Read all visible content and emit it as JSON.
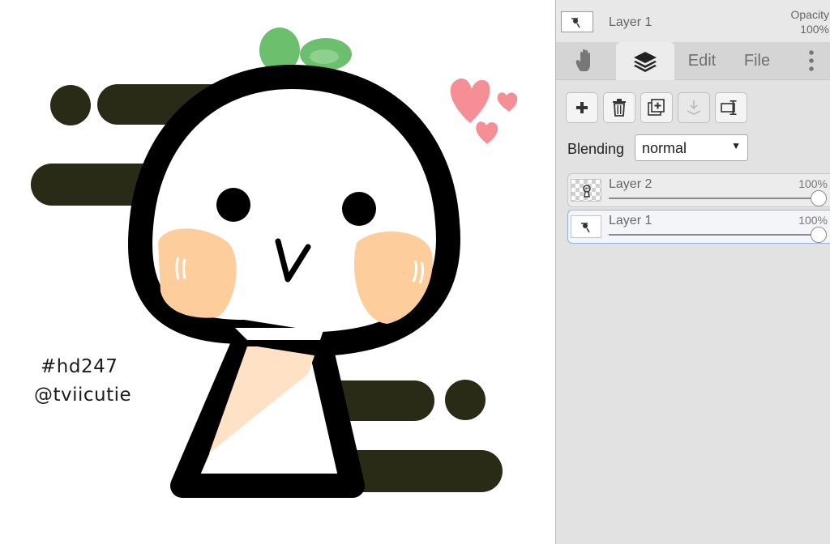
{
  "canvas": {
    "hashtag": "#hd247",
    "handle": "@tviicutie"
  },
  "colors": {
    "outline": "#000000",
    "stripes": "#2a2b17",
    "blush": "#fdcd9c",
    "leaf": "#6cbf6c",
    "hearts": "#f58e95",
    "panel_bg": "#e2e2e2"
  },
  "panel": {
    "current_layer_name": "Layer 1",
    "opacity_label": "Opacity",
    "opacity_value": "100%",
    "tabs": [
      {
        "icon": "hand-icon"
      },
      {
        "icon": "layers-icon",
        "active": true
      },
      {
        "label": "Edit"
      },
      {
        "label": "File"
      },
      {
        "icon": "more-vertical-icon"
      }
    ],
    "toolbar": [
      {
        "icon": "plus-icon"
      },
      {
        "icon": "trash-icon"
      },
      {
        "icon": "duplicate-layer-icon"
      },
      {
        "icon": "merge-down-icon",
        "disabled": true
      },
      {
        "icon": "layer-properties-icon"
      }
    ],
    "blending_label": "Blending",
    "blending_value": "normal",
    "layers": [
      {
        "name": "Layer 2",
        "opacity_label": "100%",
        "opacity": 1.0,
        "selected": false
      },
      {
        "name": "Layer 1",
        "opacity_label": "100%",
        "opacity": 1.0,
        "selected": true
      }
    ]
  }
}
